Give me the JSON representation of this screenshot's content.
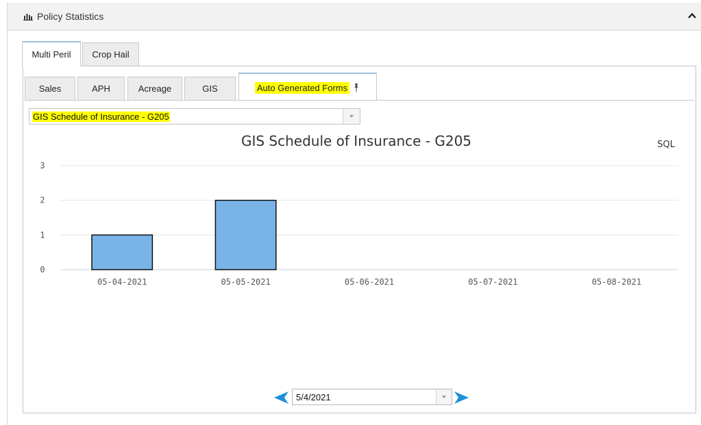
{
  "panel": {
    "title": "Policy Statistics",
    "icon": "bar-chart-icon",
    "collapse_icon": "chevron-up-icon"
  },
  "outer_tabs": [
    {
      "label": "Multi Peril",
      "active": true
    },
    {
      "label": "Crop Hail",
      "active": false
    }
  ],
  "inner_tabs": [
    {
      "label": "Sales",
      "active": false
    },
    {
      "label": "APH",
      "active": false
    },
    {
      "label": "Acreage",
      "active": false
    },
    {
      "label": "GIS",
      "active": false
    },
    {
      "label": "Auto Generated Forms",
      "active": true,
      "pinned": true,
      "highlighted": true
    }
  ],
  "report_select": {
    "value": "GIS Schedule of Insurance - G205",
    "highlighted": true
  },
  "chart_data": {
    "type": "bar",
    "title": "GIS Schedule of Insurance - G205",
    "corner_label": "SQL",
    "categories": [
      "05-04-2021",
      "05-05-2021",
      "05-06-2021",
      "05-07-2021",
      "05-08-2021"
    ],
    "values": [
      1,
      2,
      0,
      0,
      0
    ],
    "ylim": [
      0,
      3
    ],
    "yticks": [
      0,
      1,
      2,
      3
    ],
    "xlabel": "",
    "ylabel": "",
    "grid": true,
    "bar_color": "#7ab3e8",
    "bar_stroke": "#111111"
  },
  "date_nav": {
    "value": "5/4/2021",
    "prev_icon": "arrow-left-icon",
    "next_icon": "arrow-right-icon",
    "arrow_color": "#1e90d8"
  },
  "colors": {
    "highlight": "#ffff00",
    "tab_active_border": "#9ec0e0"
  }
}
